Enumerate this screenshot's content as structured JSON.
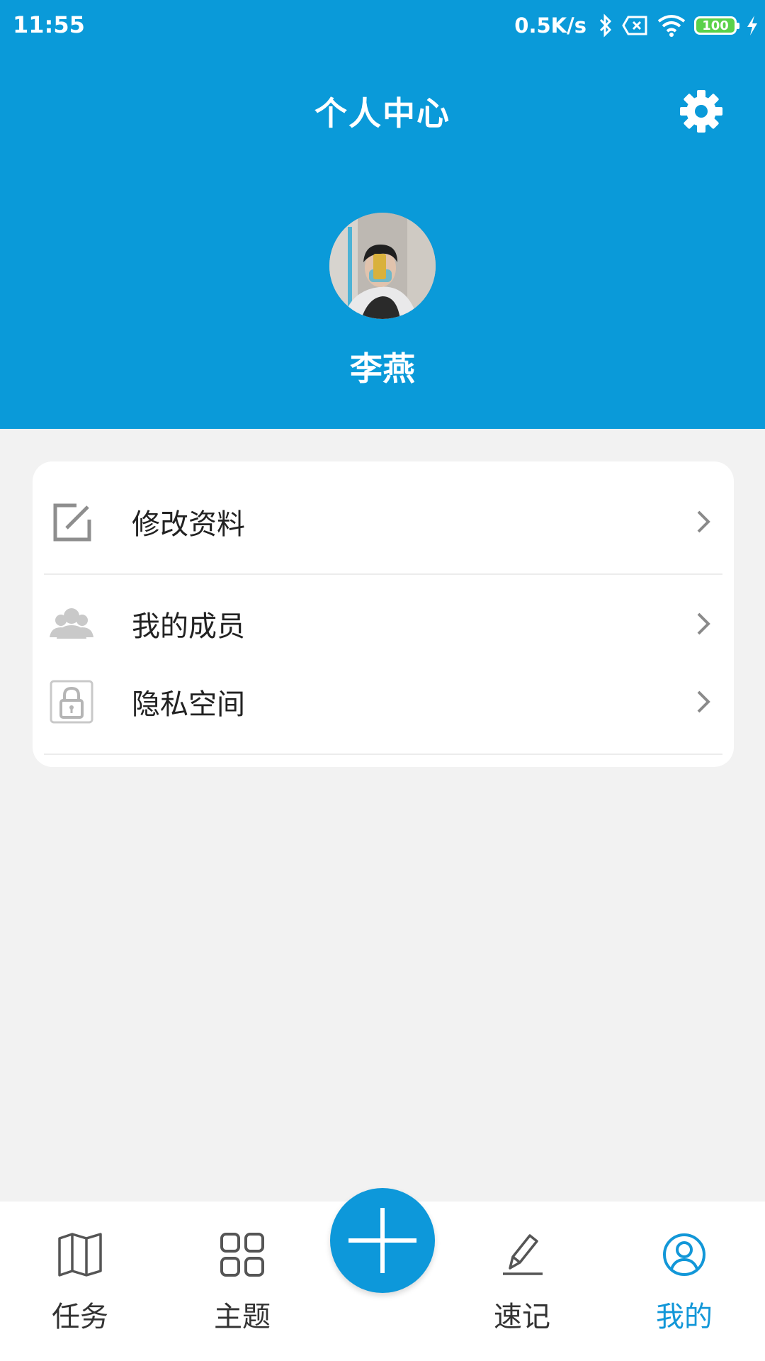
{
  "status_bar": {
    "time": "11:55",
    "net_speed": "0.5K/s",
    "battery": "100",
    "icons": [
      "bluetooth-icon",
      "sim-off-icon",
      "wifi-icon",
      "battery-icon",
      "charging-icon"
    ]
  },
  "header": {
    "title": "个人中心",
    "settings_icon": "gear-icon",
    "user_name": "李燕"
  },
  "menu": {
    "items": [
      {
        "label": "修改资料",
        "icon": "edit-icon"
      },
      {
        "label": "我的成员",
        "icon": "members-icon"
      },
      {
        "label": "隐私空间",
        "icon": "lock-icon"
      }
    ]
  },
  "tabbar": {
    "tabs": [
      {
        "label": "任务",
        "icon": "map-icon"
      },
      {
        "label": "主题",
        "icon": "grid-icon"
      },
      {
        "label": "速记",
        "icon": "pen-icon"
      },
      {
        "label": "我的",
        "icon": "user-circle-icon"
      }
    ],
    "active": "我的",
    "add_icon": "plus-icon"
  },
  "colors": {
    "header_bg": "#0a9ad9",
    "active_tab": "#1297d8",
    "page_bg": "#f2f2f2"
  }
}
